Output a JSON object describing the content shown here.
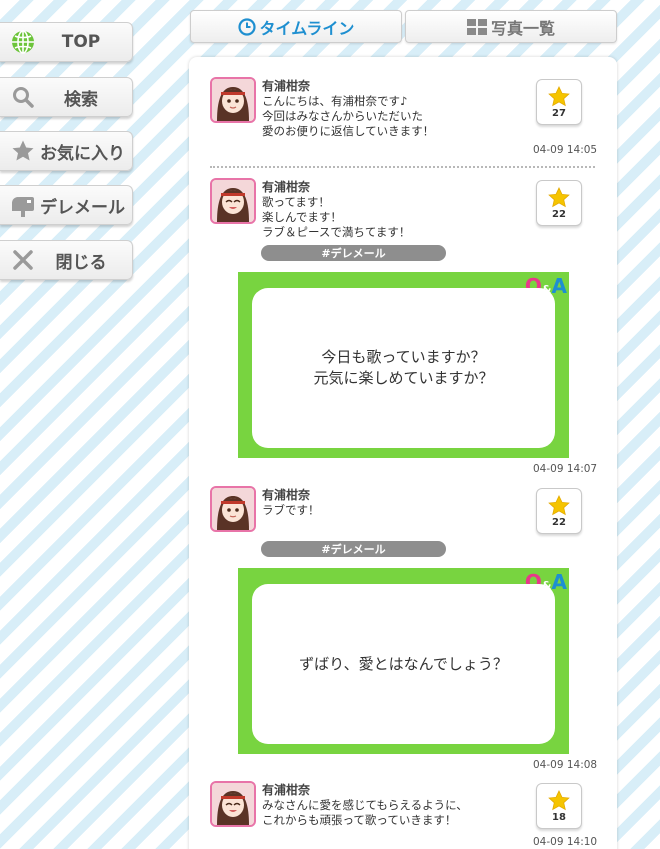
{
  "sidebar": {
    "items": [
      {
        "label": "TOP",
        "icon": "globe-icon"
      },
      {
        "label": "検索",
        "icon": "search-icon"
      },
      {
        "label": "お気に入り",
        "icon": "star-icon"
      },
      {
        "label": "デレメール",
        "icon": "mailbox-icon"
      },
      {
        "label": "閉じる",
        "icon": "close-icon"
      }
    ]
  },
  "tabs": [
    {
      "label": "タイムライン",
      "icon": "clock-icon",
      "active": true
    },
    {
      "label": "写真一覧",
      "icon": "grid-icon",
      "active": false
    }
  ],
  "colors": {
    "accent_blue": "#1e8fd0",
    "qa_green": "#78d440",
    "star_yellow": "#f5c400",
    "avatar_border": "#e874a8"
  },
  "posts": [
    {
      "name": "有浦柑奈",
      "text": "こんにちは、有浦柑奈です♪\n今回はみなさんからいただいた\n愛のお便りに返信していきます！",
      "stars": "27",
      "time": "04-09 14:05"
    },
    {
      "name": "有浦柑奈",
      "text": "歌ってます！\n楽しんでます！\nラブ＆ピースで満ちてます！",
      "stars": "22",
      "tag": "#デレメール",
      "qa": "今日も歌っていますか？\n元気に楽しめていますか？",
      "time": "04-09 14:07"
    },
    {
      "name": "有浦柑奈",
      "text": "ラブです！",
      "stars": "22",
      "tag": "#デレメール",
      "qa": "ずばり、愛とはなんでしょう？",
      "time": "04-09 14:08"
    },
    {
      "name": "有浦柑奈",
      "text": "みなさんに愛を感じてもらえるように、\nこれからも頑張って歌っていきます！",
      "stars": "18",
      "time": "04-09 14:10"
    }
  ],
  "qa_badge": {
    "q": "Q",
    "amp": "&",
    "a": "A"
  }
}
